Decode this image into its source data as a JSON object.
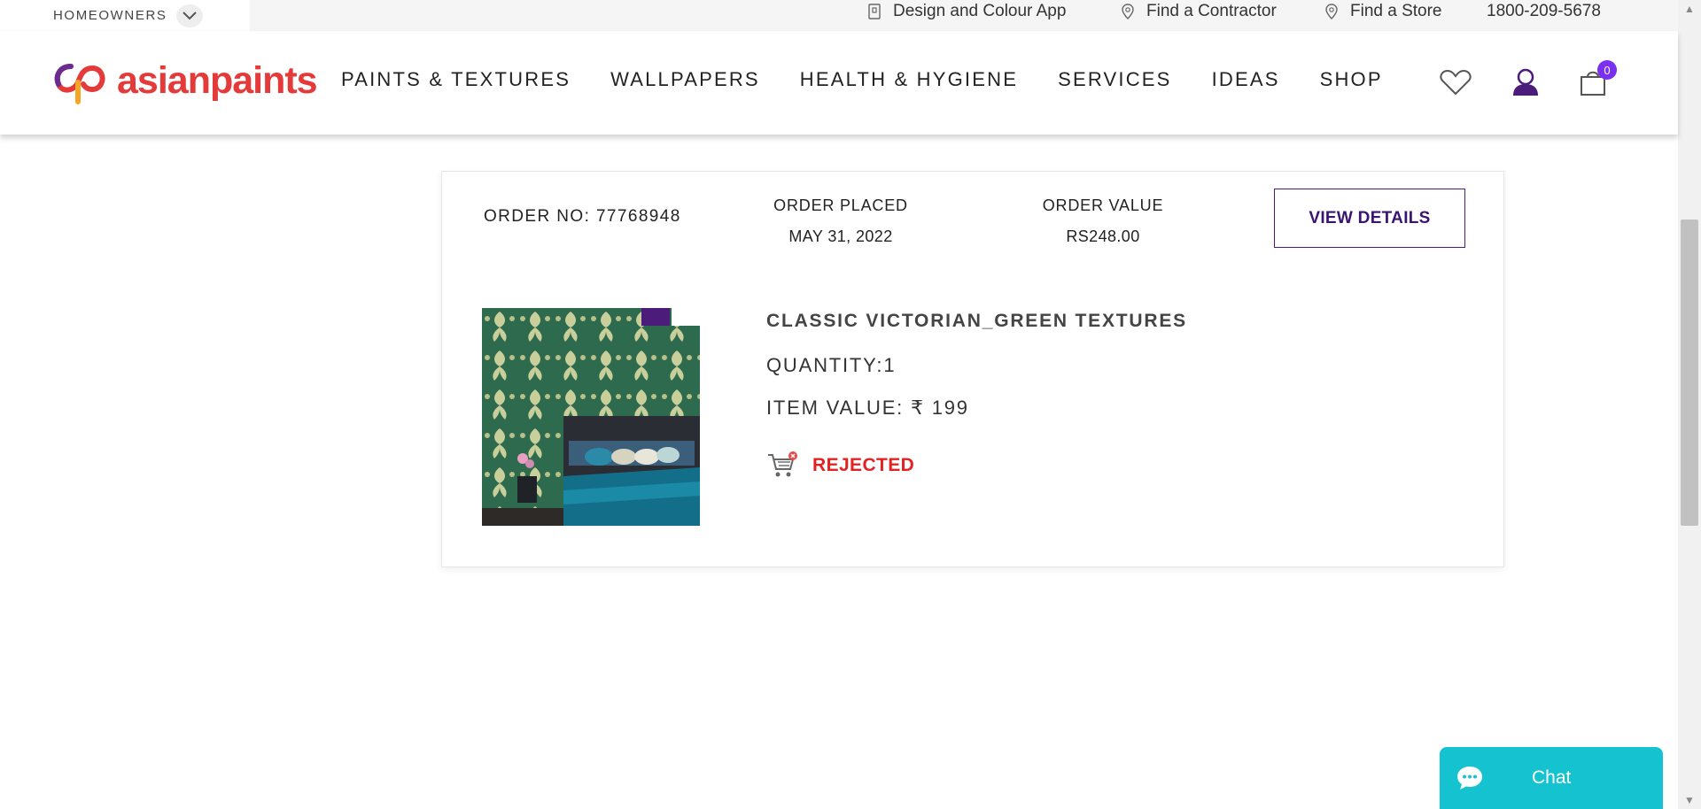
{
  "topbar": {
    "segment_label": "HOMEOWNERS",
    "design_app": "Design and Colour App",
    "find_contractor": "Find a Contractor",
    "find_store": "Find a Store",
    "phone": "1800-209-5678"
  },
  "header": {
    "logo_text": "asianpaints",
    "nav": [
      "PAINTS & TEXTURES",
      "WALLPAPERS",
      "HEALTH & HYGIENE",
      "SERVICES",
      "IDEAS",
      "SHOP"
    ],
    "cart_count": "0"
  },
  "order": {
    "order_no": "ORDER NO: 77768948",
    "placed_label": "ORDER PLACED",
    "placed_value": "MAY 31, 2022",
    "value_label": "ORDER VALUE",
    "value_value": "RS248.00",
    "view_details": "VIEW DETAILS"
  },
  "item": {
    "title": "CLASSIC VICTORIAN_GREEN TEXTURES",
    "quantity": "QUANTITY:1",
    "value": "ITEM VALUE: ₹ 199",
    "status": "REJECTED"
  },
  "chat": {
    "label": "Chat"
  },
  "colors": {
    "brand_red": "#e53a3a",
    "brand_purple": "#4b1c7a",
    "badge_purple": "#7a2ff2",
    "status_red": "#e02424",
    "chat_teal": "#15c2cf"
  }
}
